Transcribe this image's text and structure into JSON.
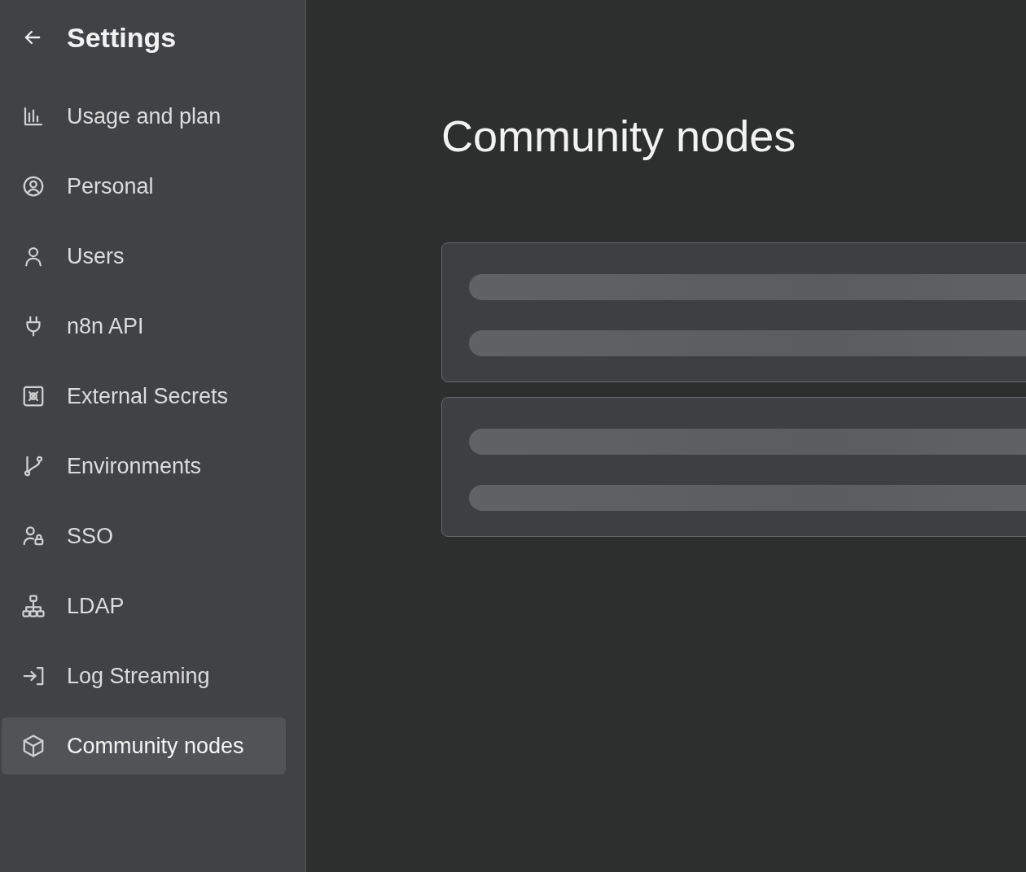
{
  "sidebar": {
    "title": "Settings",
    "items": [
      {
        "label": "Usage and plan",
        "selected": false
      },
      {
        "label": "Personal",
        "selected": false
      },
      {
        "label": "Users",
        "selected": false
      },
      {
        "label": "n8n API",
        "selected": false
      },
      {
        "label": "External Secrets",
        "selected": false
      },
      {
        "label": "Environments",
        "selected": false
      },
      {
        "label": "SSO",
        "selected": false
      },
      {
        "label": "LDAP",
        "selected": false
      },
      {
        "label": "Log Streaming",
        "selected": false
      },
      {
        "label": "Community nodes",
        "selected": true
      }
    ]
  },
  "main": {
    "title": "Community nodes"
  }
}
